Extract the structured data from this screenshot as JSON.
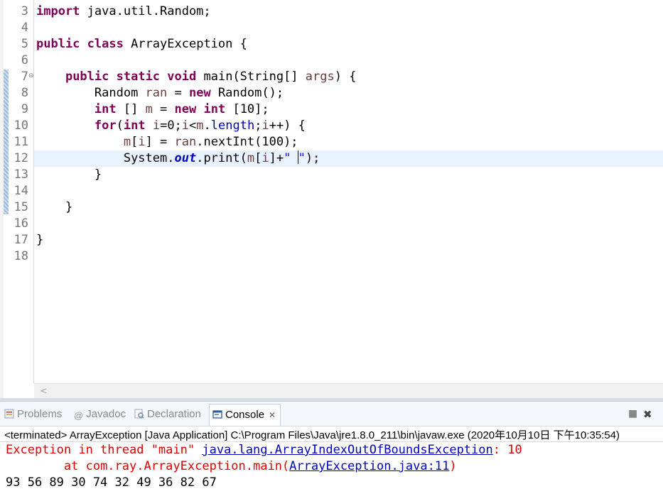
{
  "editor": {
    "line_numbers": [
      "3",
      "4",
      "5",
      "6",
      "7",
      "8",
      "9",
      "10",
      "11",
      "12",
      "13",
      "14",
      "15",
      "16",
      "17",
      "18"
    ],
    "code": {
      "l3_kw": "import",
      "l3_rest": " java.util.Random;",
      "l5_kw1": "public",
      "l5_kw2": "class",
      "l5_rest": " ArrayException {",
      "l7_kw1": "public",
      "l7_kw2": "static",
      "l7_kw3": "void",
      "l7_a": " main(String[] ",
      "l7_var": "args",
      "l7_b": ") {",
      "l8_a": "Random ",
      "l8_var": "ran",
      "l8_b": " = ",
      "l8_kw": "new",
      "l8_c": " Random();",
      "l9_kw1": "int",
      "l9_a": " [] ",
      "l9_var": "m",
      "l9_b": " = ",
      "l9_kw2": "new",
      "l9_kw3": "int",
      "l9_c": " [10];",
      "l10_kw1": "for",
      "l10_a": "(",
      "l10_kw2": "int",
      "l10_var1": "i",
      "l10_b": "=0;",
      "l10_var2": "i",
      "l10_c": "<",
      "l10_var3": "m",
      "l10_d": ".",
      "l10_fld": "length",
      "l10_e": ";",
      "l10_var4": "i",
      "l10_f": "++) {",
      "l11_var1": "m",
      "l11_a": "[",
      "l11_var2": "i",
      "l11_b": "] = ",
      "l11_var3": "ran",
      "l11_c": ".nextInt(100);",
      "l12_a": "System.",
      "l12_fld": "out",
      "l12_b": ".print(",
      "l12_var1": "m",
      "l12_c": "[",
      "l12_var2": "i",
      "l12_d": "]+",
      "l12_str1": "\" ",
      "l12_str2": "\"",
      "l12_e": ");",
      "l13": "}",
      "l15": "}",
      "l17": "}"
    },
    "fold_icon": "minus-circle-icon",
    "scroll_left_icon": "chevron-left-icon"
  },
  "panel": {
    "tabs": [
      {
        "label": "Problems",
        "icon": "problems-icon"
      },
      {
        "label": "Javadoc",
        "icon": "at-icon"
      },
      {
        "label": "Declaration",
        "icon": "declaration-icon"
      },
      {
        "label": "Console",
        "icon": "console-icon",
        "active": true
      }
    ],
    "close_glyph": "✕",
    "toolbar": {
      "stop_icon": "■",
      "remove_icon": "✖"
    },
    "status": "<terminated> ArrayException [Java Application] C:\\Program Files\\Java\\jre1.8.0_211\\bin\\javaw.exe (2020年10月10日 下午10:35:54)",
    "output": {
      "err1_a": "Exception in thread \"main\" ",
      "err1_link": "java.lang.ArrayIndexOutOfBoundsException",
      "err1_b": ": 10",
      "err2_a": "\tat com.ray.ArrayException.main(",
      "err2_link": "ArrayException.java:11",
      "err2_b": ")",
      "stdout": "93 56 89 30 74 32 49 36 82 67"
    }
  },
  "colors": {
    "keyword": "#7f0055",
    "error": "#e00000",
    "link": "#0000c0",
    "string": "#2a00ff"
  }
}
